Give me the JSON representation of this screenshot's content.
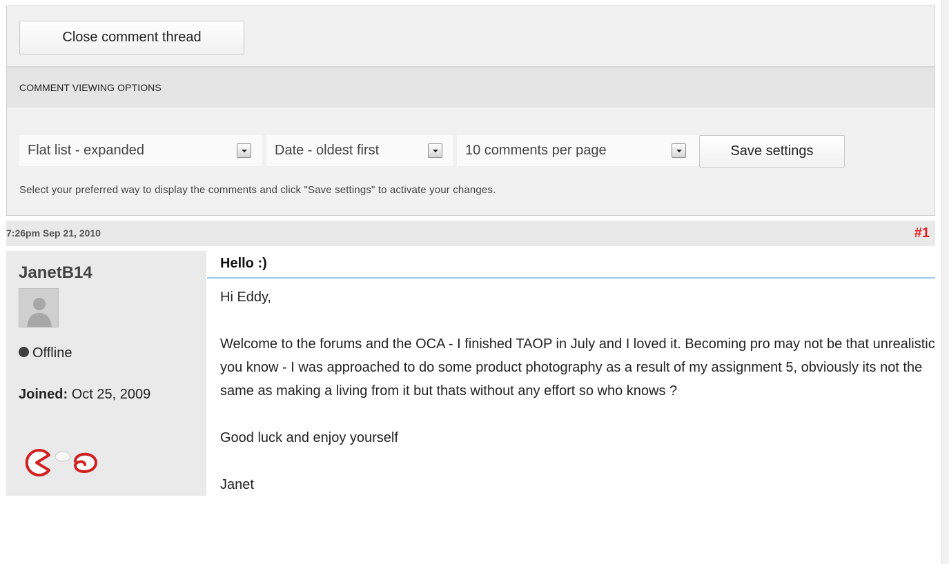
{
  "thread": {
    "close_label": "Close comment thread"
  },
  "viewing_options": {
    "header": "COMMENT VIEWING OPTIONS",
    "display_mode": "Flat list - expanded",
    "sort_order": "Date - oldest first",
    "per_page": "10 comments per page",
    "save_label": "Save settings",
    "help_text": "Select your preferred way to display the comments and click \"Save settings\" to activate your changes."
  },
  "comment": {
    "timestamp": "7:26pm Sep 21, 2010",
    "number": "#1",
    "author": {
      "name": "JanetB14",
      "status": "Offline",
      "joined_label": "Joined:",
      "joined_date": "Oct 25, 2009"
    },
    "title": "Hello :)",
    "body": {
      "greeting": "Hi Eddy,",
      "paragraph": "Welcome to the forums and the OCA - I finished TAOP in July and I loved it. Becoming pro may not be that unrealistic you know - I was approached to do some product photography as a result of my assignment 5, obviously its not the same as making a living from it but thats without any effort so who knows ?",
      "closing": "Good luck and enjoy yourself",
      "signature": "Janet"
    }
  },
  "icons": {
    "avatar": "default-user-avatar-icon",
    "status": "status-dot-icon",
    "badges": "speech-bubbles-icon",
    "caret": "chevron-down-icon"
  },
  "colors": {
    "post_number": "#e02020",
    "title_rule": "#9ec9ea",
    "panel_bg": "#eaeaea"
  }
}
